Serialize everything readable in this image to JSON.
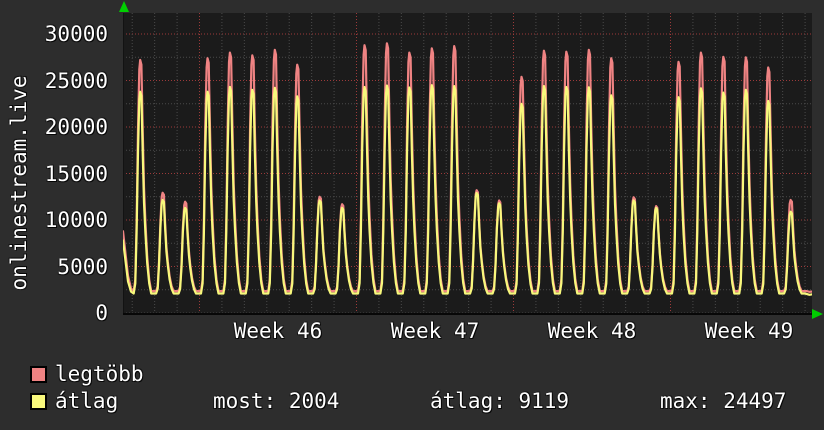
{
  "page": {
    "background": "#2d2d2d",
    "plot_background": "#1b1b1b",
    "text_color": "#ffffff",
    "arrow_color": "#00cf00"
  },
  "chart_data": {
    "type": "line",
    "vertical_title": "onlinestream.live",
    "ylim": [
      0,
      32250
    ],
    "yticks": [
      0,
      5000,
      10000,
      15000,
      20000,
      25000,
      30000
    ],
    "x_tick_labels": [
      "Week 46",
      "Week 47",
      "Week 48",
      "Week 49"
    ],
    "grid": {
      "major_color": "#9c3a3a",
      "minor_color": "#4a4a4a",
      "major_y_step": 5000,
      "minor_y_step": 2500,
      "major_x_step": "1 week",
      "minor_x_step": "1 day",
      "style": "dotted"
    },
    "legend_position": "bottom-left",
    "series": [
      {
        "name": "legtöbb",
        "meaning": "daily maximum",
        "color": "#ef8383",
        "baseline": 2350,
        "daily_peaks": [
          27200,
          12930,
          11970,
          27400,
          28000,
          27700,
          28300,
          26700,
          12500,
          11700,
          28800,
          29000,
          28000,
          28450,
          28700,
          13200,
          12100,
          25400,
          28200,
          28100,
          28300,
          27400,
          12440,
          11500,
          27000,
          28000,
          27550,
          27500,
          26400,
          12150
        ]
      },
      {
        "name": "átlag",
        "meaning": "daily average",
        "color": "#f8f87c",
        "baseline": 2100,
        "daily_peaks": [
          23800,
          12150,
          11300,
          23800,
          24300,
          24000,
          24200,
          23300,
          12100,
          11300,
          24300,
          24450,
          24250,
          24497,
          24400,
          12900,
          11800,
          22500,
          24400,
          24300,
          24260,
          23400,
          12100,
          11300,
          23200,
          24150,
          23700,
          24000,
          22800,
          10890
        ]
      }
    ],
    "stats": {
      "most": 2004,
      "atlag": 9119,
      "max": 24497
    }
  },
  "legend": {
    "items": [
      {
        "label": "legtöbb",
        "color": "#ef8383"
      },
      {
        "label": "átlag",
        "color": "#f8f87c"
      }
    ]
  },
  "stats_row": {
    "most": "most: 2004",
    "atlag": "átlag: 9119",
    "max": "max: 24497"
  }
}
